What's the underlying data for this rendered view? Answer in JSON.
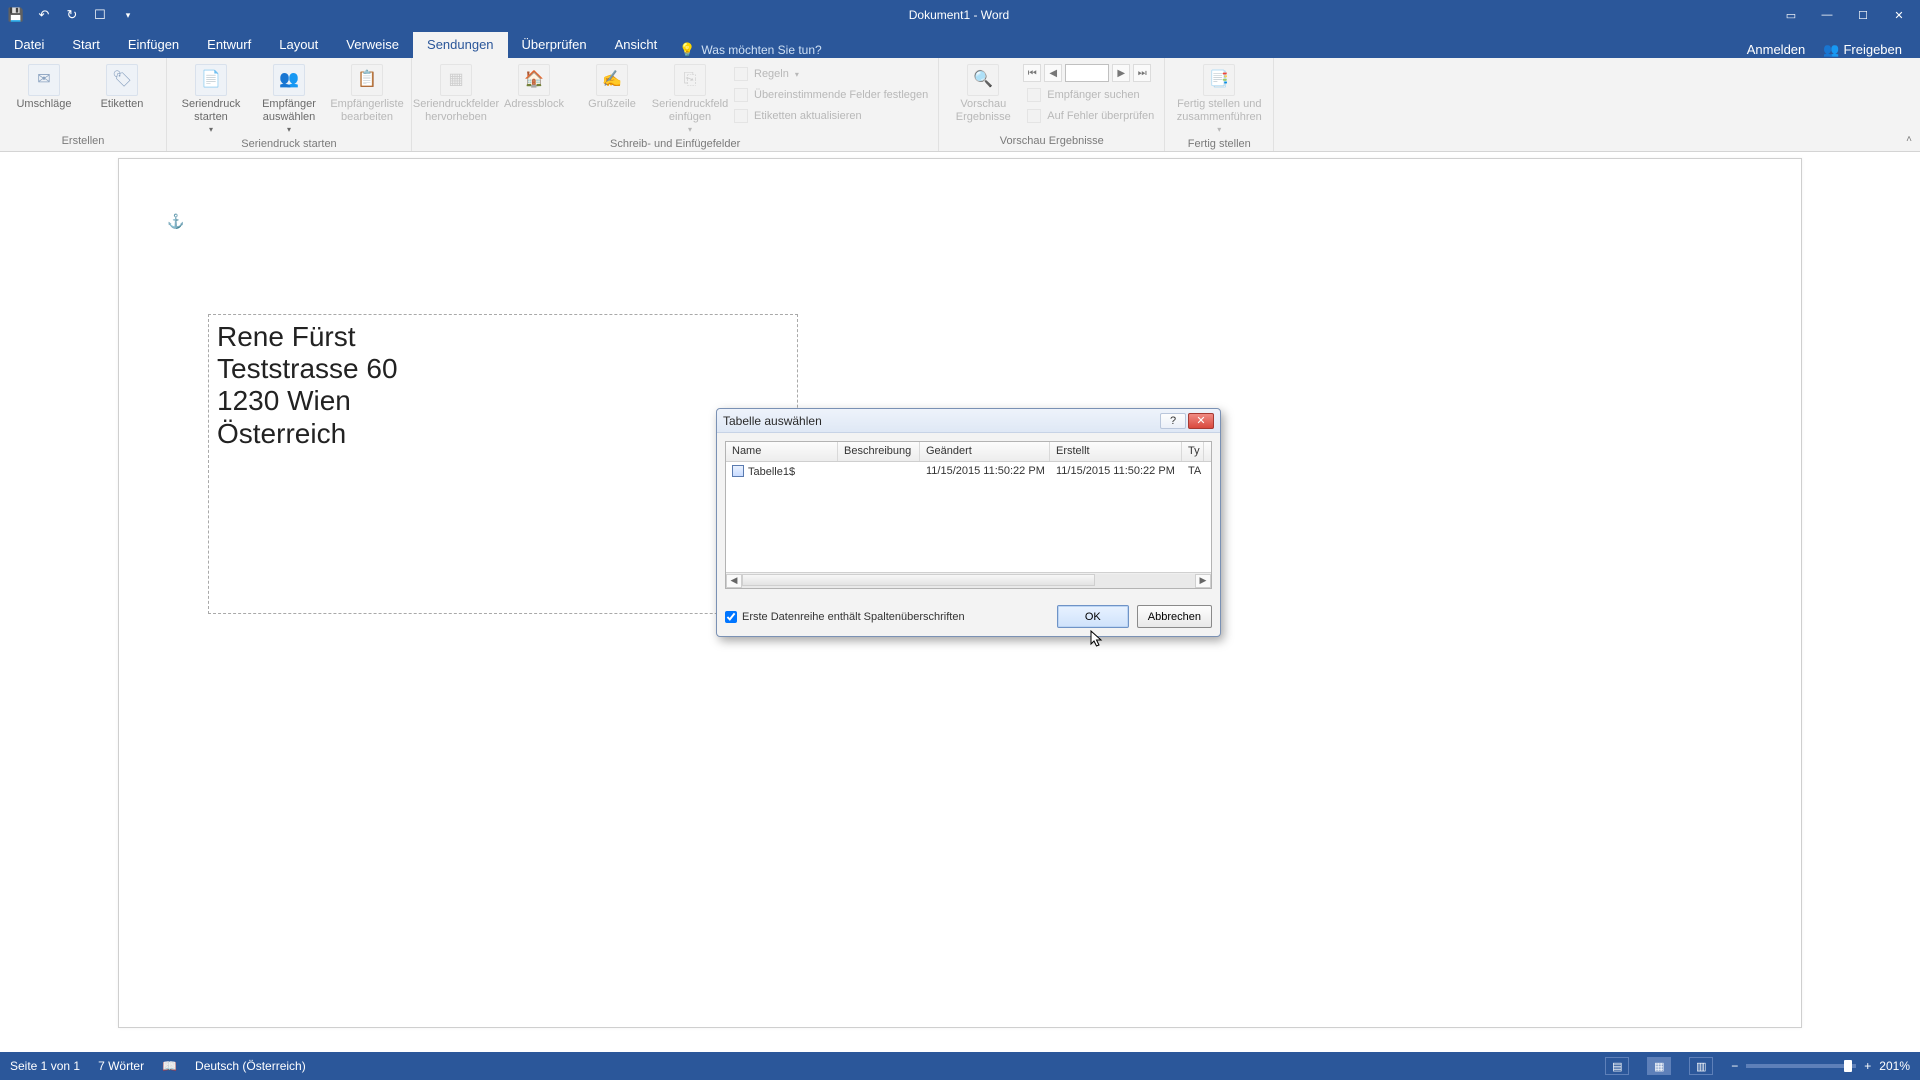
{
  "titlebar": {
    "doc_title": "Dokument1 - Word"
  },
  "tabs": {
    "datei": "Datei",
    "start": "Start",
    "einfuegen": "Einfügen",
    "entwurf": "Entwurf",
    "layout": "Layout",
    "verweise": "Verweise",
    "sendungen": "Sendungen",
    "ueberpruefen": "Überprüfen",
    "ansicht": "Ansicht",
    "tellme_placeholder": "Was möchten Sie tun?",
    "anmelden": "Anmelden",
    "freigeben": "Freigeben"
  },
  "ribbon": {
    "erstellen": {
      "umschlaege": "Umschläge",
      "etiketten": "Etiketten",
      "label": "Erstellen"
    },
    "start_merge": {
      "seriendruck_starten": "Seriendruck starten",
      "empfaenger_auswaehlen": "Empfänger auswählen",
      "empfaengerliste_bearbeiten": "Empfängerliste bearbeiten",
      "label": "Seriendruck starten"
    },
    "fields": {
      "felder_hervorheben": "Seriendruckfelder hervorheben",
      "adressblock": "Adressblock",
      "grusszeile": "Grußzeile",
      "feld_einfuegen": "Seriendruckfeld einfügen",
      "regeln": "Regeln",
      "felder_festlegen": "Übereinstimmende Felder festlegen",
      "etiketten_aktualisieren": "Etiketten aktualisieren",
      "label": "Schreib- und Einfügefelder"
    },
    "preview": {
      "vorschau": "Vorschau Ergebnisse",
      "empfaenger_suchen": "Empfänger suchen",
      "fehler_pruefen": "Auf Fehler überprüfen",
      "label": "Vorschau Ergebnisse"
    },
    "finish": {
      "fertig": "Fertig stellen und zusammenführen",
      "label": "Fertig stellen"
    }
  },
  "document": {
    "addr_line1": "Rene Fürst",
    "addr_line2": "Teststrasse 60",
    "addr_line3": "1230 Wien",
    "addr_line4": "Österreich"
  },
  "dialog": {
    "title": "Tabelle auswählen",
    "columns": {
      "name": "Name",
      "beschreibung": "Beschreibung",
      "geaendert": "Geändert",
      "erstellt": "Erstellt",
      "typ": "Ty"
    },
    "row": {
      "name": "Tabelle1$",
      "beschreibung": "",
      "geaendert": "11/15/2015 11:50:22 PM",
      "erstellt": "11/15/2015 11:50:22 PM",
      "typ": "TA"
    },
    "checkbox_label": "Erste Datenreihe enthält Spaltenüberschriften",
    "ok": "OK",
    "cancel": "Abbrechen"
  },
  "statusbar": {
    "page": "Seite 1 von 1",
    "words": "7 Wörter",
    "lang": "Deutsch (Österreich)",
    "zoom_minus": "−",
    "zoom_plus": "+",
    "zoom_pct": "201%"
  }
}
